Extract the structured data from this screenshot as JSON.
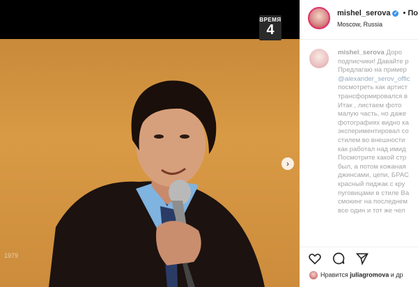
{
  "post": {
    "username": "mishel_serova",
    "verified_glyph": "✓",
    "follow_label": "• Под",
    "location": "Moscow, Russia",
    "caption_username": "mishel_serova",
    "caption_lines": [
      "Доро",
      "подписчики! Давайте р",
      "Предлагаю на пример",
      "@alexander_serov_offic",
      "посмотреть как артист",
      "трансформировался в",
      "Итак , листаем фото",
      "малую часть, но даже",
      "фотографиях видно ка",
      "экспериментировал со",
      "стилем во внешности",
      "как работал над имид",
      "Посмотрите какой стр",
      "был, а потом кожаная",
      "джинсами, цепи, БРАС",
      "красный пиджак с кру",
      "пуговицами в стиле Ва",
      "смокинг на последнем",
      "все один и тот же чел"
    ],
    "liked_by_prefix": "Нравится",
    "liked_by_user": "juliagromova",
    "liked_by_suffix": "и др"
  },
  "media": {
    "tv_channel_top": "ВРЕМЯ",
    "tv_channel_number": "4",
    "watermark": "1979",
    "next_glyph": "›"
  },
  "icons": {
    "like": "heart-icon",
    "comment": "comment-icon",
    "share": "share-icon"
  },
  "colors": {
    "background": "#000000",
    "backdrop": "#d99a45",
    "verified": "#3897f0",
    "story_ring": "#e1306c"
  }
}
